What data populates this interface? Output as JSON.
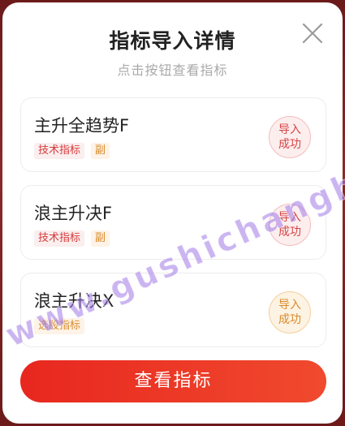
{
  "modal": {
    "title": "指标导入详情",
    "subtitle": "点击按钮查看指标"
  },
  "items": [
    {
      "name": "主升全趋势F",
      "tags": [
        "技术指标",
        "副"
      ],
      "badge": "导入成功",
      "badge_color": "#d64545"
    },
    {
      "name": "浪主升决F",
      "tags": [
        "技术指标",
        "副"
      ],
      "badge": "导入成功",
      "badge_color": "#d64545"
    },
    {
      "name": "浪主升决X",
      "tags": [
        "选股指标"
      ],
      "badge": "导入成功",
      "badge_color": "#d98a2b"
    }
  ],
  "button": {
    "label": "查看指标"
  },
  "watermark": "www.gushichanghong.com",
  "colors": {
    "accent": "#e8271f",
    "tag_red": "#d63a3a",
    "tag_orange": "#d98a2b"
  }
}
